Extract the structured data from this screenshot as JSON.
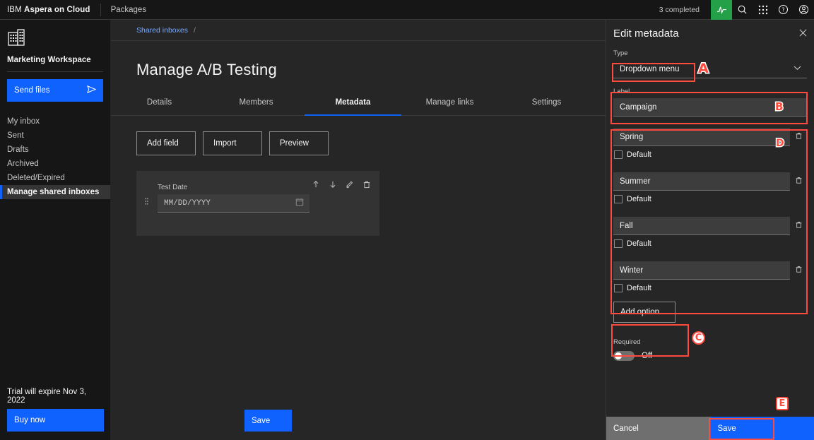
{
  "topbar": {
    "brand_ibm": "IBM",
    "brand_product": "Aspera on Cloud",
    "packages_label": "Packages",
    "completed_text": "3 completed",
    "icons": [
      "activity-icon",
      "search-icon",
      "app-switcher-icon",
      "help-icon",
      "account-icon"
    ]
  },
  "sidebar": {
    "workspace_icon": "building-icon",
    "workspace_name": "Marketing Workspace",
    "send_files_label": "Send files",
    "send_files_icon": "send-icon",
    "items": [
      {
        "label": "My inbox",
        "active": false
      },
      {
        "label": "Sent",
        "active": false
      },
      {
        "label": "Drafts",
        "active": false
      },
      {
        "label": "Archived",
        "active": false
      },
      {
        "label": "Deleted/Expired",
        "active": false
      },
      {
        "label": "Manage shared inboxes",
        "active": true
      }
    ],
    "trial_text": "Trial will expire Nov 3, 2022",
    "buy_now_label": "Buy now"
  },
  "main": {
    "breadcrumb_link": "Shared inboxes",
    "breadcrumb_sep": "/",
    "page_title": "Manage A/B Testing",
    "tabs": [
      {
        "label": "Details",
        "active": false
      },
      {
        "label": "Members",
        "active": false
      },
      {
        "label": "Metadata",
        "active": true
      },
      {
        "label": "Manage links",
        "active": false
      },
      {
        "label": "Settings",
        "active": false
      }
    ],
    "toolbar": [
      {
        "label": "Add field"
      },
      {
        "label": "Import"
      },
      {
        "label": "Preview"
      }
    ],
    "field_card": {
      "label": "Test Date",
      "input_placeholder": "MM/DD/YYYY",
      "calendar_icon": "calendar-icon",
      "drag_icon": "drag-handle-icon",
      "actions": [
        "move-up-icon",
        "move-down-icon",
        "edit-icon",
        "delete-icon"
      ]
    },
    "save_label": "Save"
  },
  "panel": {
    "title": "Edit metadata",
    "close_icon": "close-icon",
    "type_label": "Type",
    "type_value": "Dropdown menu",
    "type_chevron": "chevron-down-icon",
    "label_label": "Label",
    "label_value": "Campaign",
    "options": [
      {
        "value": "Spring",
        "default_label": "Default",
        "default_checked": false
      },
      {
        "value": "Summer",
        "default_label": "Default",
        "default_checked": false
      },
      {
        "value": "Fall",
        "default_label": "Default",
        "default_checked": false
      },
      {
        "value": "Winter",
        "default_label": "Default",
        "default_checked": false
      }
    ],
    "add_option_label": "Add option",
    "required_label": "Required",
    "required_state": "Off",
    "cancel_label": "Cancel",
    "save_label": "Save"
  },
  "annotations": {
    "markers": [
      {
        "id": "A",
        "style": "plain"
      },
      {
        "id": "B",
        "style": "plain"
      },
      {
        "id": "C",
        "style": "ring"
      },
      {
        "id": "D",
        "style": "plain"
      },
      {
        "id": "E",
        "style": "box"
      }
    ],
    "highlight_color": "#ff4b3e"
  }
}
